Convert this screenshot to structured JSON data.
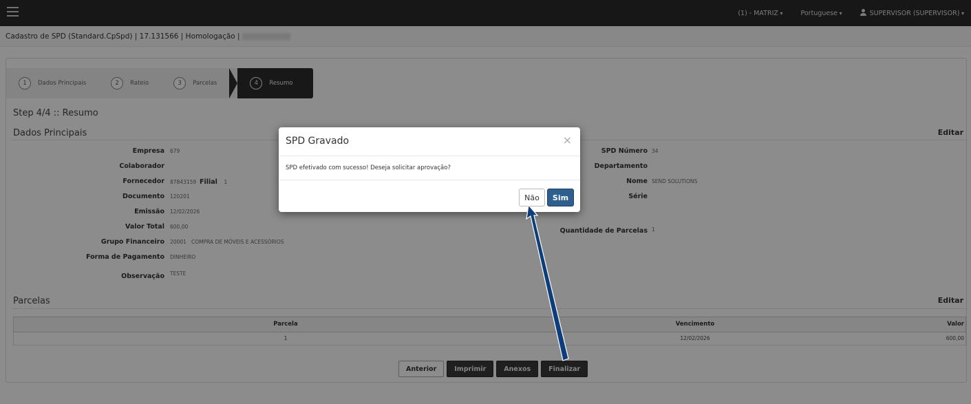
{
  "topbar": {
    "company": "(1) - MATRIZ",
    "language": "Portuguese",
    "user": "SUPERVISOR (SUPERVISOR)"
  },
  "breadcrumb": "Cadastro de SPD (Standard.CpSpd) | 17.131566 | Homologação |",
  "wizard": {
    "steps": [
      {
        "num": "1",
        "label": "Dados Principais"
      },
      {
        "num": "2",
        "label": "Rateio"
      },
      {
        "num": "3",
        "label": "Parcelas"
      },
      {
        "num": "4",
        "label": "Resumo"
      }
    ]
  },
  "step_title": "Step 4/4 :: Resumo",
  "dados": {
    "title": "Dados Principais",
    "edit": "Editar",
    "empresa_label": "Empresa",
    "empresa_value": "679",
    "colaborador_label": "Colaborador",
    "fornecedor_label": "Fornecedor",
    "fornecedor_value": "87843159",
    "filial_label": "Filial",
    "filial_value": "1",
    "documento_label": "Documento",
    "documento_value": "120201",
    "emissao_label": "Emissão",
    "emissao_value": "12/02/2026",
    "valor_label": "Valor Total",
    "valor_value": "600,00",
    "grupo_label": "Grupo Financeiro",
    "grupo_value": "20001   COMPRA DE MÓVEIS E ACESSÓRIOS",
    "forma_label": "Forma de Pagamento",
    "forma_value": "DINHEIRO",
    "obs_label": "Observação",
    "obs_value": "TESTE",
    "spd_label": "SPD Número",
    "spd_value": "34",
    "depto_label": "Departamento",
    "nome_label": "Nome",
    "nome_value": "SEND SOLUTIONS",
    "serie_label": "Série",
    "qtd_label": "Quantidade de Parcelas",
    "qtd_value": "1"
  },
  "parcelas": {
    "title": "Parcelas",
    "edit": "Editar",
    "columns": [
      "Parcela",
      "Vencimento",
      "Valor"
    ],
    "rows": [
      [
        "1",
        "12/02/2026",
        "600,00"
      ]
    ]
  },
  "buttons": {
    "anterior": "Anterior",
    "imprimir": "Imprimir",
    "anexos": "Anexos",
    "finalizar": "Finalizar"
  },
  "modal": {
    "title": "SPD Gravado",
    "close": "×",
    "message": "SPD efetivado com sucesso! Deseja solicitar aprovação?",
    "no": "Não",
    "yes": "Sim"
  },
  "colors": {
    "topbar": "#2b2b2b",
    "primary_button": "#2e5f8f",
    "arrow": "#0d3d7a"
  }
}
